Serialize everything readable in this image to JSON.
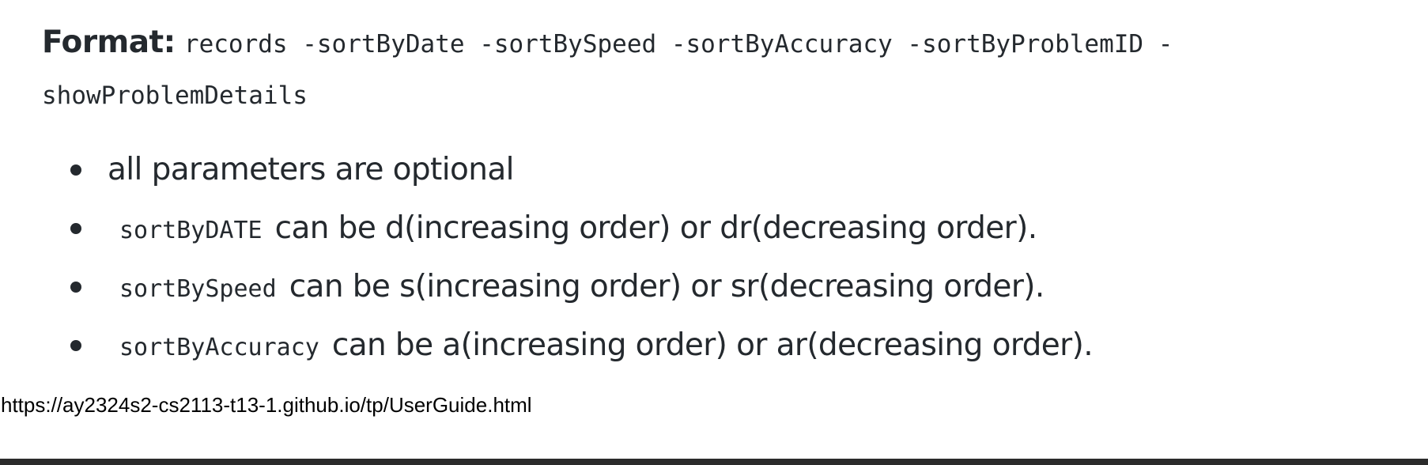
{
  "format": {
    "label": "Format:",
    "command_line1": "records -sortByDate -sortBySpeed -sortByAccuracy -sortByProblemID -",
    "command_line2": "showProblemDetails"
  },
  "bullets": [
    {
      "code": "",
      "text": "all parameters are optional"
    },
    {
      "code": "sortByDATE",
      "text": "can be d(increasing order) or dr(decreasing order)."
    },
    {
      "code": "sortBySpeed",
      "text": "can be s(increasing order) or sr(decreasing order)."
    },
    {
      "code": "sortByAccuracy",
      "text": "can be a(increasing order) or ar(decreasing order)."
    }
  ],
  "status_bar": {
    "url": "https://ay2324s2-cs2113-t13-1.github.io/tp/UserGuide.html"
  },
  "colors": {
    "text": "#24292e",
    "background": "#ffffff",
    "bottom_bar": "#2b2b2b"
  }
}
